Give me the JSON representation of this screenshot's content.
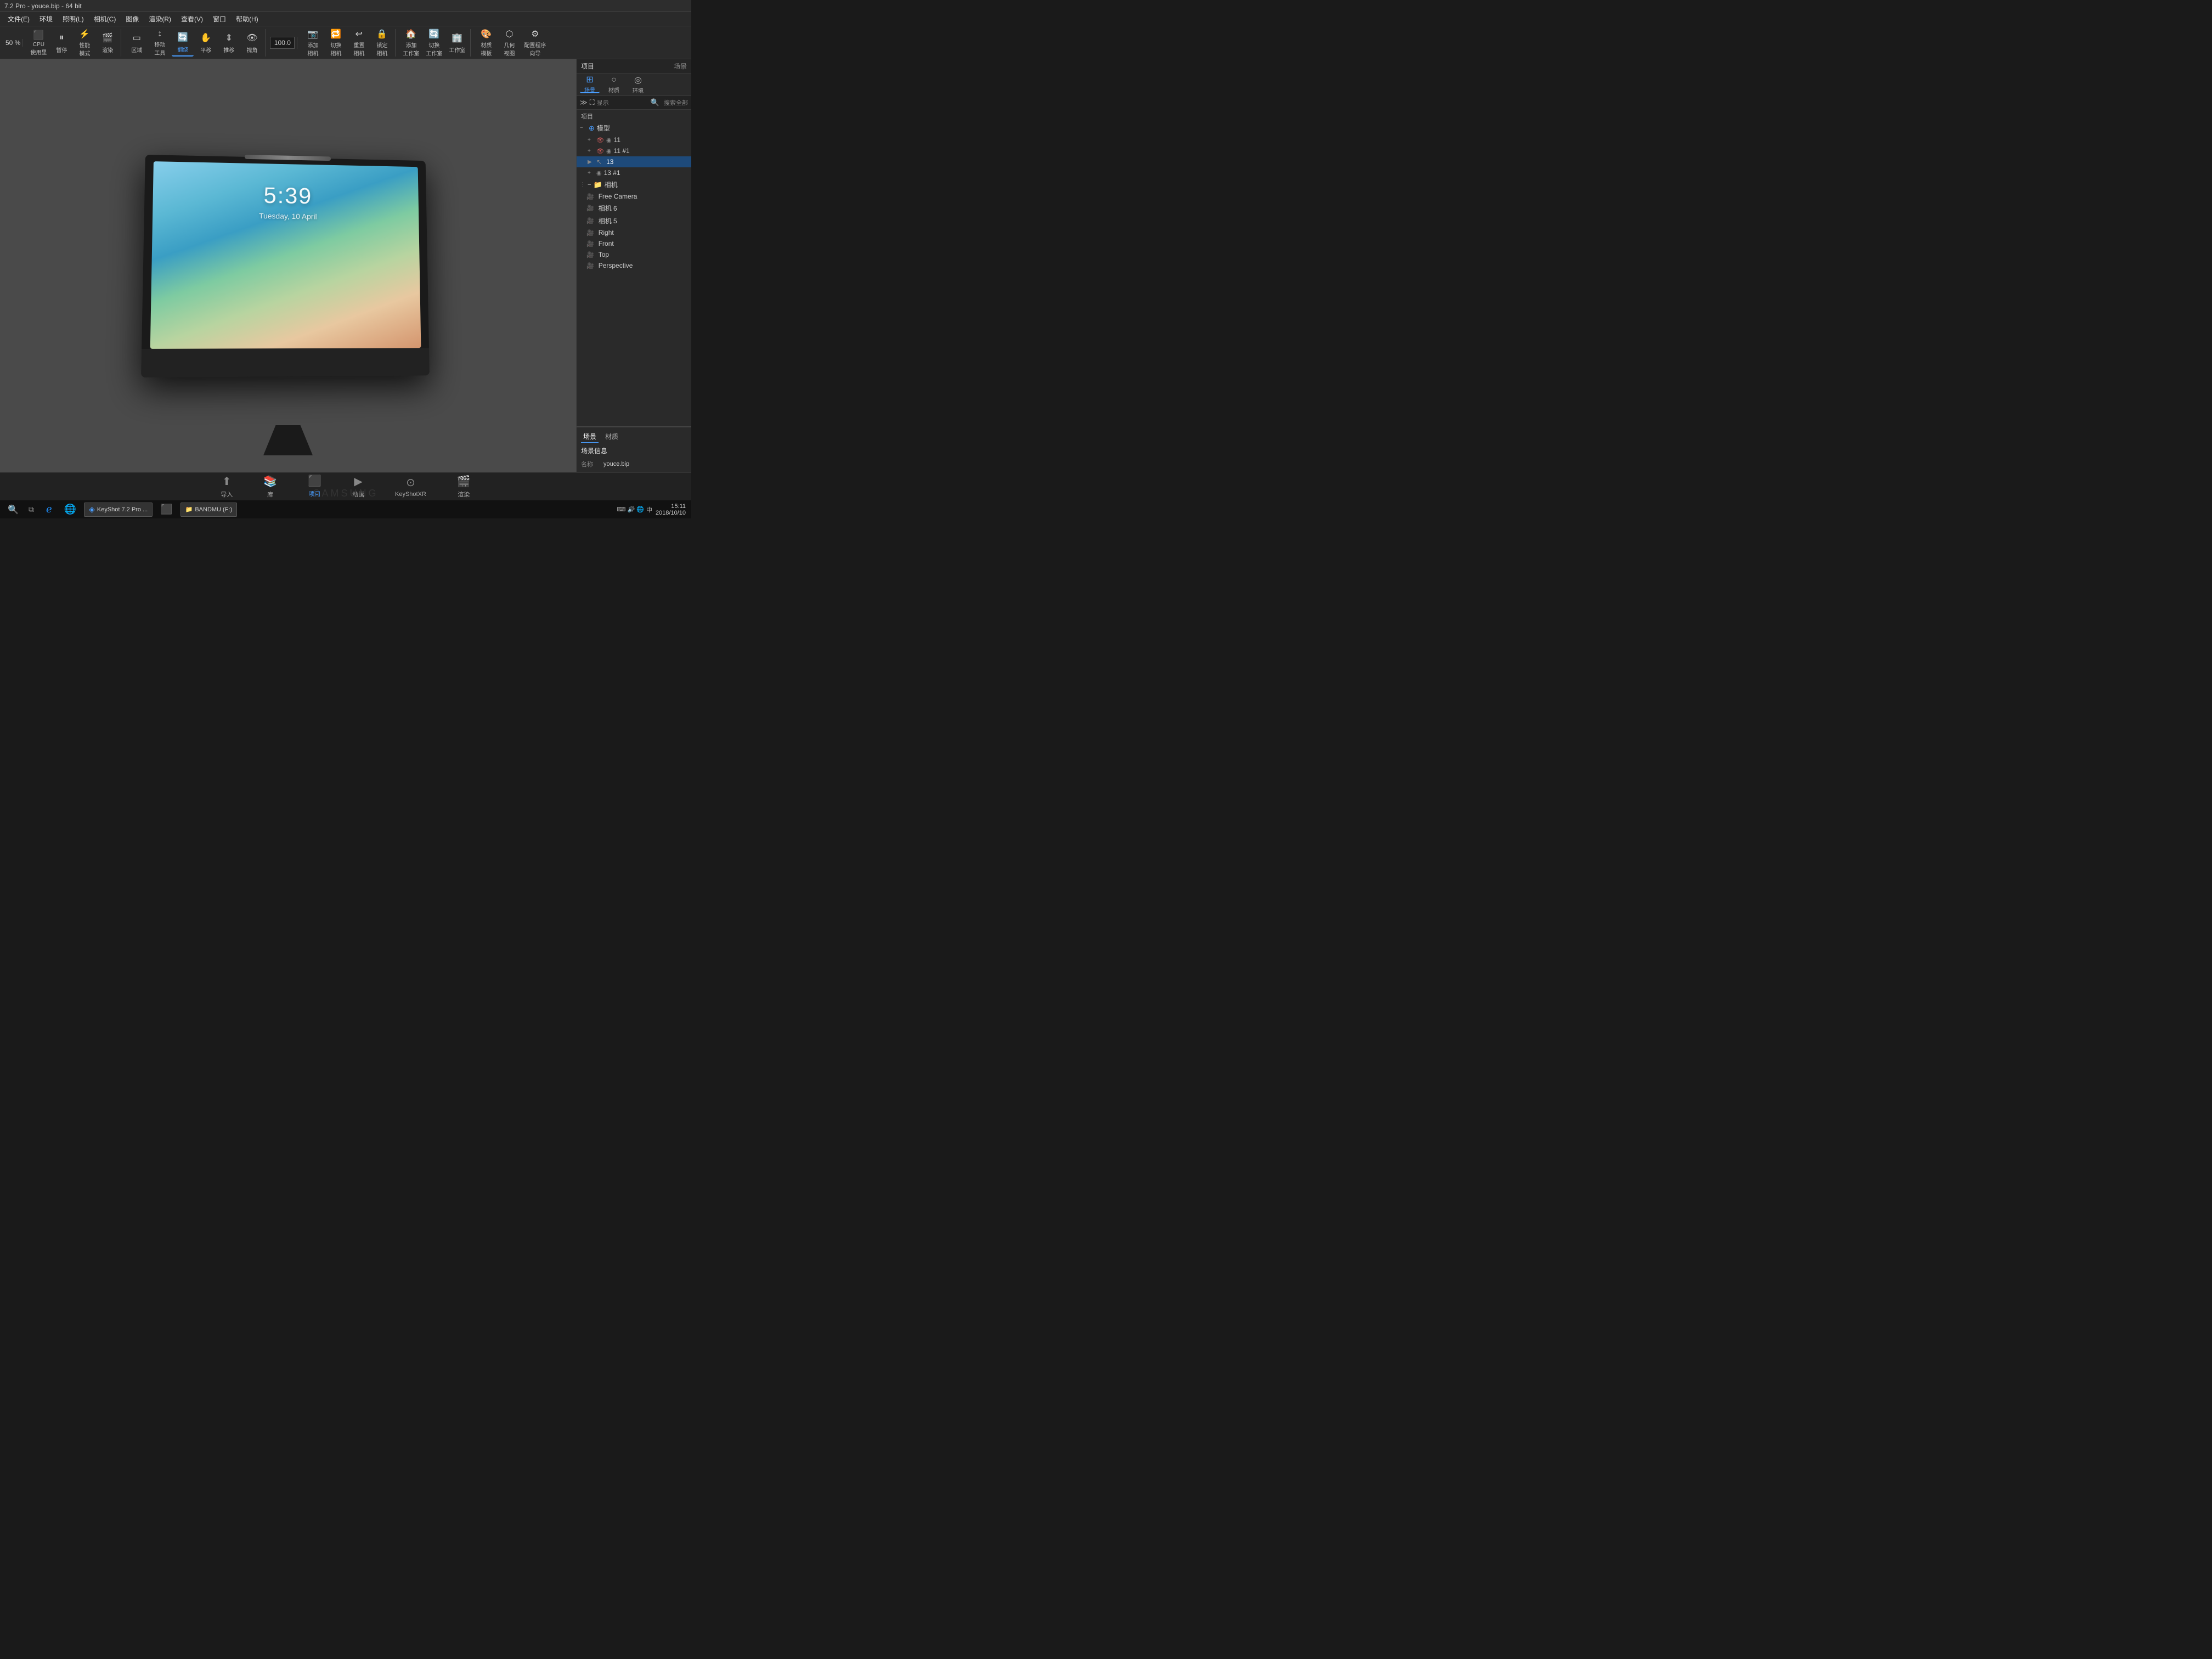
{
  "titlebar": {
    "text": "7.2 Pro - youce.bip - 64 bit"
  },
  "menubar": {
    "items": [
      "文件(E)",
      "环境",
      "照明(L)",
      "相机(C)",
      "图像",
      "渲染(R)",
      "查看(V)",
      "窗口",
      "帮助(H)"
    ]
  },
  "toolbar": {
    "percent": "50 %",
    "value": "100.0",
    "buttons": [
      {
        "label": "CPU\n使用里",
        "key": "cpu-usage"
      },
      {
        "label": "暂停",
        "key": "pause"
      },
      {
        "label": "性能\n模式",
        "key": "performance"
      },
      {
        "label": "渲染",
        "key": "render"
      },
      {
        "label": "区域",
        "key": "area"
      },
      {
        "label": "移动\n工具",
        "key": "move-tool"
      },
      {
        "label": "翻绕",
        "key": "rotate",
        "active": true
      },
      {
        "label": "平移",
        "key": "pan"
      },
      {
        "label": "推移",
        "key": "push"
      },
      {
        "label": "视角",
        "key": "view"
      },
      {
        "label": "添加\n相机",
        "key": "add-camera"
      },
      {
        "label": "切换\n相机",
        "key": "switch-camera"
      },
      {
        "label": "重置\n相机",
        "key": "reset-camera"
      },
      {
        "label": "锁定\n相机",
        "key": "lock-camera"
      },
      {
        "label": "添加\n工作室",
        "key": "add-studio"
      },
      {
        "label": "切换\n工作室",
        "key": "switch-studio"
      },
      {
        "label": "工作室",
        "key": "studio"
      },
      {
        "label": "材质\n模板",
        "key": "material-template"
      },
      {
        "label": "几何\n视图",
        "key": "geo-view"
      },
      {
        "label": "配置程序\n向导",
        "key": "config-wizard"
      }
    ]
  },
  "right_panel": {
    "top_tabs": [
      "项目",
      "场景"
    ],
    "header_tabs": [
      "场景",
      "材质",
      "环境"
    ],
    "search_placeholder": "搜索全部",
    "scene_label": "项目",
    "tree": {
      "model_group": {
        "label": "模型",
        "expanded": true,
        "items": [
          {
            "id": "11",
            "label": "11",
            "selected": false
          },
          {
            "id": "11-1",
            "label": "11 #1",
            "selected": false
          },
          {
            "id": "13",
            "label": "13",
            "selected": true
          },
          {
            "id": "13-1",
            "label": "13 #1",
            "selected": false
          }
        ]
      },
      "camera_group": {
        "label": "相机",
        "expanded": true,
        "items": [
          {
            "label": "Free Camera"
          },
          {
            "label": "相机 6"
          },
          {
            "label": "相机 5"
          },
          {
            "label": "Right"
          },
          {
            "label": "Front"
          },
          {
            "label": "Top"
          },
          {
            "label": "Perspective"
          }
        ]
      }
    },
    "lower_tabs": [
      "场景",
      "材质"
    ],
    "scene_info": {
      "title": "场景信息",
      "name_label": "名称",
      "name_value": "youce.bip"
    }
  },
  "viewport": {
    "ipad": {
      "time": "5:39",
      "date": "Tuesday, 10 April"
    }
  },
  "bottom_bar": {
    "icons": [
      {
        "label": "导入",
        "key": "import"
      },
      {
        "label": "库",
        "key": "library"
      },
      {
        "label": "项目",
        "key": "project",
        "active": true
      },
      {
        "label": "动画",
        "key": "animation"
      },
      {
        "label": "KeyShotXR",
        "key": "keyshotxr"
      },
      {
        "label": "渲染",
        "key": "render-bottom"
      }
    ]
  },
  "taskbar": {
    "app_name": "KeyShot 7.2 Pro ...",
    "bandmu": "BANDMU (F:)",
    "time": "15:11",
    "date": "2018/10/10",
    "lang": "中",
    "samsung": "SAMSUNG"
  }
}
